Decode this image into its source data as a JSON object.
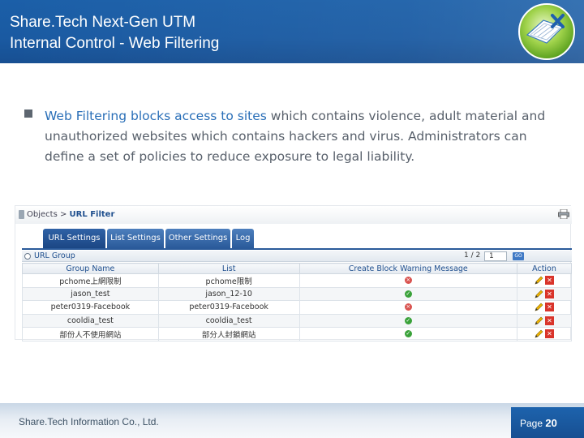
{
  "header": {
    "title_line1": "Share.Tech Next-Gen UTM",
    "title_line2": "Internal Control - Web Filtering"
  },
  "body": {
    "highlight": "Web Filtering blocks access to sites",
    "text": " which contains violence, adult material and unauthorized websites which contains hackers and virus. Administrators can define a set of policies to reduce exposure to legal liability."
  },
  "screenshot": {
    "breadcrumb_prefix": "Objects > ",
    "breadcrumb_current": "URL Filter",
    "tabs": [
      "URL Settings",
      "List Settings",
      "Other Settings",
      "Log"
    ],
    "group_label": "URL Group",
    "pager_text": "1 / 2",
    "page_input": "1",
    "go_label": "GO",
    "columns": [
      "Group Name",
      "List",
      "Create Block Warning Message",
      "Action"
    ],
    "rows": [
      {
        "group": "pchome上網限制",
        "list": "pchome限制",
        "status": "error"
      },
      {
        "group": "jason_test",
        "list": "jason_12-10",
        "status": "ok"
      },
      {
        "group": "peter0319-Facebook",
        "list": "peter0319-Facebook",
        "status": "error"
      },
      {
        "group": "cooldia_test",
        "list": "cooldia_test",
        "status": "ok"
      },
      {
        "group": "部份人不使用網站",
        "list": "部分人封鎖網站",
        "status": "ok"
      }
    ]
  },
  "footer": {
    "company": "Share.Tech Information Co., Ltd.",
    "page_label": "Page ",
    "page_number": "20"
  },
  "colors": {
    "header_blue": "#1a5aa2",
    "highlight_blue": "#2a6fb8",
    "body_gray": "#58606b"
  }
}
